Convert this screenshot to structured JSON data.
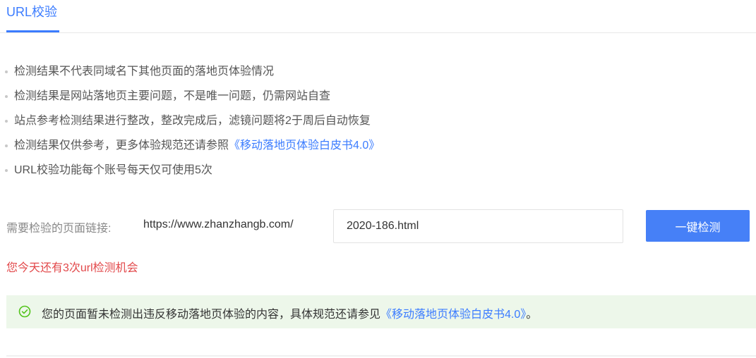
{
  "tabs": [
    {
      "label": "URL校验",
      "active": true
    }
  ],
  "notes": [
    {
      "text": "检测结果不代表同域名下其他页面的落地页体验情况"
    },
    {
      "text": "检测结果是网站落地页主要问题，不是唯一问题，仍需网站自查"
    },
    {
      "text": "站点参考检测结果进行整改，整改完成后，滤镜问题将2于周后自动恢复"
    },
    {
      "text": "检测结果仅供参考，更多体验规范还请参照",
      "link": "《移动落地页体验白皮书4.0》"
    },
    {
      "text": "URL校验功能每个账号每天仅可使用5次"
    }
  ],
  "url_check": {
    "label": "需要检验的页面链接:",
    "prefix": "https://www.zhanzhangb.com/",
    "input_value": "2020-186.html",
    "button_label": "一键检测"
  },
  "chances_text": "您今天还有3次url检测机会",
  "result": {
    "icon": "check-circle-icon",
    "text": "您的页面暂未检测出违反移动落地页体验的内容，具体规范还请参见",
    "link": "《移动落地页体验白皮书4.0》",
    "suffix": "。"
  },
  "colors": {
    "accent": "#3b7cff",
    "button": "#4680f7",
    "warning": "#e2484a",
    "success_bg": "#edf7ea",
    "success_icon": "#52c41a"
  }
}
